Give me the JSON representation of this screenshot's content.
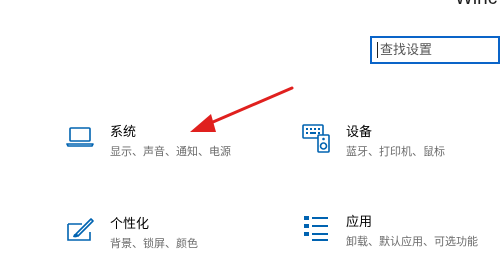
{
  "window": {
    "title": "Winc"
  },
  "search": {
    "placeholder": "查找设置"
  },
  "tiles": [
    {
      "title": "系统",
      "desc": "显示、声音、通知、电源",
      "icon": "laptop-icon"
    },
    {
      "title": "设备",
      "desc": "蓝牙、打印机、鼠标",
      "icon": "keyboard-speaker-icon"
    },
    {
      "title": "个性化",
      "desc": "背景、锁屏、颜色",
      "icon": "paint-brush-icon"
    },
    {
      "title": "应用",
      "desc": "卸载、默认应用、可选功能",
      "icon": "app-list-icon"
    }
  ],
  "colors": {
    "accent": "#0063b1",
    "arrow": "#e0201e",
    "search_border": "#0a64c8"
  }
}
